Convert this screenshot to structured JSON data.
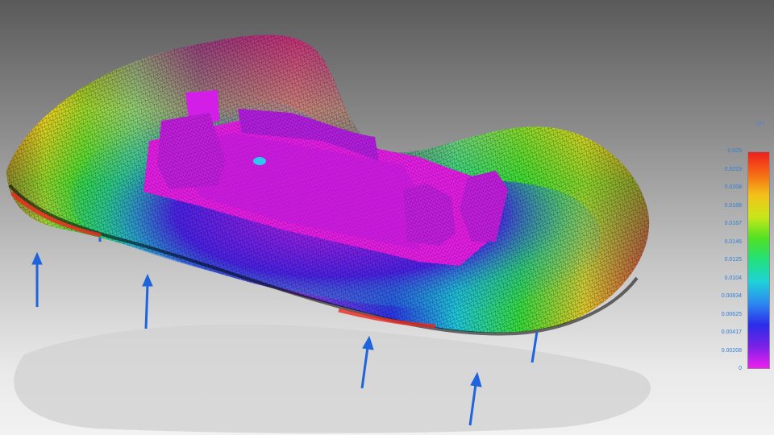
{
  "viewport": {
    "scene": "deformation-mesh-plot",
    "colors": {
      "background_top": "#5a5a5a",
      "background_bottom": "#f2f2f2",
      "arrow": "#1e64dc",
      "part": "#e61ee6"
    }
  },
  "legend": {
    "unit": "mm",
    "ticks": [
      "0.025",
      "0.0229",
      "0.0208",
      "0.0188",
      "0.0167",
      "0.0146",
      "0.0125",
      "0.0104",
      "0.00834",
      "0.00625",
      "0.00417",
      "0.00208",
      "0"
    ],
    "color_scale": [
      "#f01e1e",
      "#f56a14",
      "#f3c21a",
      "#c8e71a",
      "#4fe124",
      "#22e07e",
      "#1fd2d8",
      "#2d88f0",
      "#2c2cea",
      "#7a22e6",
      "#f01ef0"
    ]
  }
}
